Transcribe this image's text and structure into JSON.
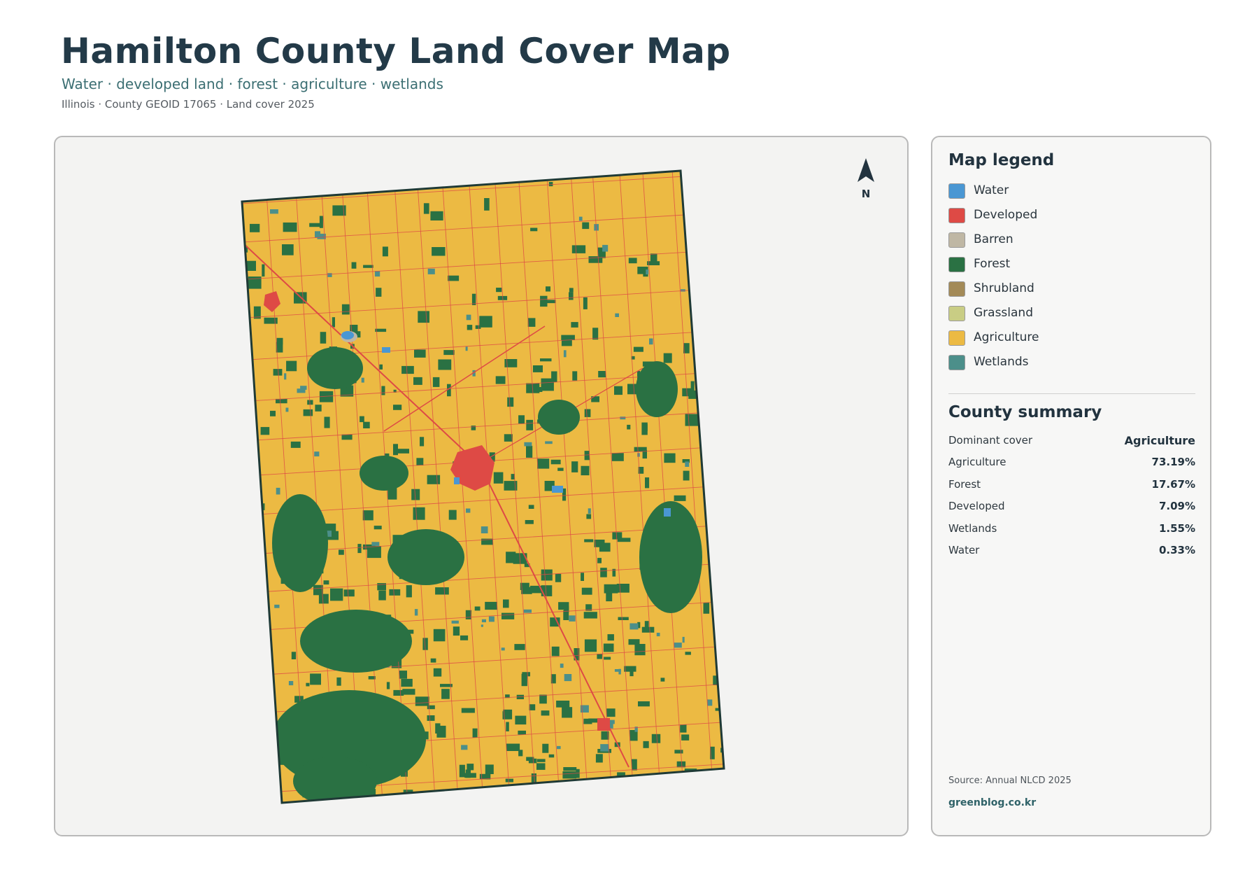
{
  "header": {
    "title": "Hamilton County Land Cover Map",
    "subtitle": "Water · developed land · forest · agriculture · wetlands",
    "meta": "Illinois · County GEOID 17065 · Land cover 2025"
  },
  "map": {
    "north_label": "N",
    "colors": {
      "water": "#4a97d3",
      "developed": "#de4a45",
      "barren": "#bfb7a4",
      "forest": "#2a7143",
      "shrubland": "#a38a57",
      "grassland": "#c9cd84",
      "agriculture": "#ecba43",
      "wetlands": "#4c8f8a",
      "outline": "#1f3a36"
    },
    "icons": [
      "north-arrow-icon"
    ]
  },
  "legend": {
    "title": "Map legend",
    "items": [
      {
        "label": "Water",
        "color": "#4a97d3"
      },
      {
        "label": "Developed",
        "color": "#de4a45"
      },
      {
        "label": "Barren",
        "color": "#bfb7a4"
      },
      {
        "label": "Forest",
        "color": "#2a7143"
      },
      {
        "label": "Shrubland",
        "color": "#a38a57"
      },
      {
        "label": "Grassland",
        "color": "#c9cd84"
      },
      {
        "label": "Agriculture",
        "color": "#ecba43"
      },
      {
        "label": "Wetlands",
        "color": "#4c8f8a"
      }
    ]
  },
  "summary": {
    "title": "County summary",
    "rows": [
      {
        "label": "Dominant cover",
        "value": "Agriculture"
      },
      {
        "label": "Agriculture",
        "value": "73.19%"
      },
      {
        "label": "Forest",
        "value": "17.67%"
      },
      {
        "label": "Developed",
        "value": "7.09%"
      },
      {
        "label": "Wetlands",
        "value": "1.55%"
      },
      {
        "label": "Water",
        "value": "0.33%"
      }
    ]
  },
  "footer": {
    "source": "Source: Annual NLCD 2025",
    "site": "greenblog.co.kr"
  }
}
